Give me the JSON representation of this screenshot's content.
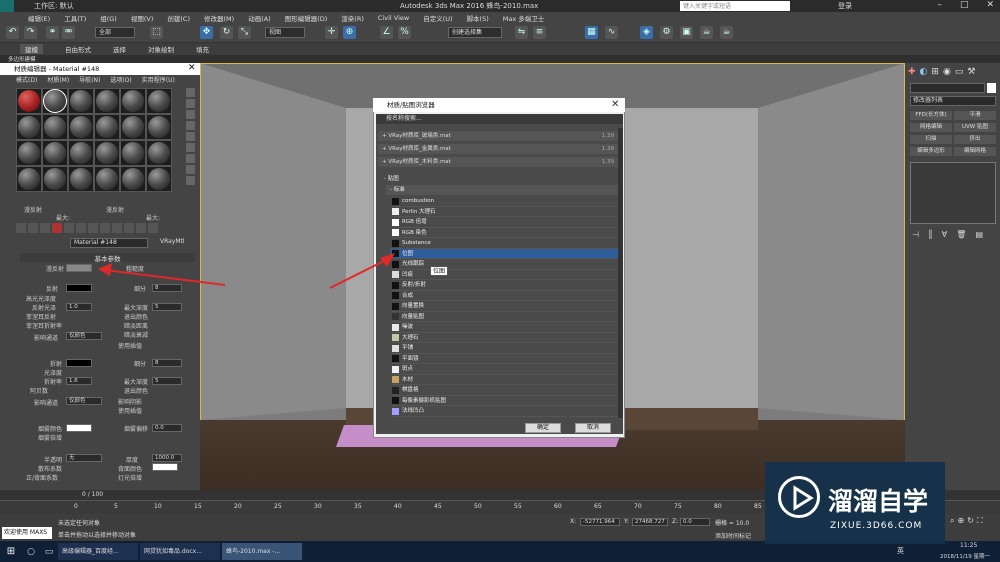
{
  "app": {
    "workspace": "工作区: 默认",
    "title": "Autodesk 3ds Max 2016    蜂鸟-2010.max",
    "search_placeholder": "键入关键字或短语",
    "user": "登录"
  },
  "menu": [
    "编辑(E)",
    "工具(T)",
    "组(G)",
    "视图(V)",
    "创建(C)",
    "修改器(M)",
    "动画(A)",
    "图形编辑器(D)",
    "渲染(R)",
    "Civil View",
    "自定义(U)",
    "脚本(S)",
    "Max 多端卫士"
  ],
  "toolbar": {
    "filter": "全部",
    "view": "视图",
    "selection_set": "创建选择集"
  },
  "ribbon": {
    "tabs": [
      "建模",
      "自由形式",
      "选择",
      "对象绘制",
      "填充"
    ],
    "sub": "多边形建模"
  },
  "material_editor": {
    "title": "材质编辑器 - Material #148",
    "menu": [
      "模式(D)",
      "材质(M)",
      "导航(N)",
      "选项(O)",
      "实用程序(U)"
    ],
    "rows1": [
      "漫反射",
      "最大:",
      "漫反射",
      "最大:"
    ],
    "name": "Material #148",
    "type": "VRayMtl",
    "rollout": "基本参数",
    "params": {
      "diffuse": "漫反射",
      "roughness": "粗糙度",
      "reflect": "反射",
      "hilight_gloss": "高光光泽度",
      "refl_gloss": "反射光泽",
      "fresnel": "菲涅耳反射",
      "fresnel_ior": "菲涅耳折射率",
      "subdivs": "细分",
      "max_depth": "最大深度",
      "exit_color": "退出颜色",
      "dim_dist": "暗淡距离",
      "dim_falloff": "暗淡衰减",
      "affect_channels": "影响通道",
      "only_color": "仅颜色",
      "use_interp": "使用插值",
      "refract": "折射",
      "glossiness": "光泽度",
      "ior": "折射率",
      "abbe": "阿贝数",
      "affect_shadows": "影响阴影",
      "fog_color": "烟雾颜色",
      "fog_mult": "烟雾倍增",
      "fog_bias": "烟雾偏移",
      "translucency": "半透明",
      "scatter_coeff": "散布系数",
      "fwd_bwd": "正/背面系数",
      "thickness": "厚度",
      "back_color": "背面颜色",
      "light_mult": "灯光倍增",
      "v_subdivs": "8",
      "v_depth": "5",
      "v_gloss": "1.0",
      "v_ior": "1.6",
      "v_fog_bias": "0.0",
      "v_thick": "1000.0",
      "none": "无"
    }
  },
  "dialog": {
    "title": "材质/贴图浏览器",
    "search": "按名称搜索...",
    "libraries": [
      {
        "name": "+ VRay材质库_玻璃类.mat",
        "size": "1.39"
      },
      {
        "name": "+ VRay材质库_金属类.mat",
        "size": "1.39"
      },
      {
        "name": "+ VRay材质库_木料类.mat",
        "size": "1.39"
      }
    ],
    "section": "- 贴图",
    "subsection": "- 标准",
    "maps": [
      {
        "name": "combustion",
        "color": "#111111"
      },
      {
        "name": "Perlin 大理石",
        "color": "#eeeeee"
      },
      {
        "name": "RGB 倍增",
        "color": "#ffffff"
      },
      {
        "name": "RGB 染色",
        "color": "#ffffff"
      },
      {
        "name": "Substance",
        "color": "#111111"
      },
      {
        "name": "位图",
        "color": "#111111"
      },
      {
        "name": "光线跟踪",
        "color": "#111111"
      },
      {
        "name": "凹痕",
        "color": "#dddddd"
      },
      {
        "name": "反射/折射",
        "color": "#111111"
      },
      {
        "name": "合成",
        "color": "#111111"
      },
      {
        "name": "向量置换",
        "color": "#111111"
      },
      {
        "name": "向量贴图",
        "color": "#333333"
      },
      {
        "name": "噪波",
        "color": "#e8e8e8"
      },
      {
        "name": "大理石",
        "color": "#c8c8a0"
      },
      {
        "name": "平铺",
        "color": "#e0e0e0"
      },
      {
        "name": "平面镜",
        "color": "#111111"
      },
      {
        "name": "斑点",
        "color": "#f0f0f0"
      },
      {
        "name": "木材",
        "color": "#c8a060"
      },
      {
        "name": "棋盘格",
        "color": "#222222"
      },
      {
        "name": "每像素摄影机贴图",
        "color": "#111111"
      },
      {
        "name": "法线凹凸",
        "color": "#a0a0ff"
      }
    ],
    "tooltip": "位图",
    "ok": "确定",
    "cancel": "取消"
  },
  "right_panel": {
    "modifier_list": "修改器列表",
    "buttons": [
      "FFD(长方体)",
      "平滑",
      "网格编辑",
      "UVW 贴图",
      "扫描",
      "挤出",
      "编辑多边形",
      "编辑网格"
    ]
  },
  "timeline": {
    "frame": "0 / 100",
    "ticks": [
      "0",
      "5",
      "10",
      "15",
      "20",
      "25",
      "30",
      "35",
      "40",
      "45",
      "50",
      "55",
      "60",
      "65",
      "70",
      "75",
      "80",
      "85"
    ]
  },
  "status": {
    "welcome": "欢迎使用 MAXS",
    "line1": "未选定任何对象",
    "line2": "单击并拖动以选择并移动对象",
    "x": "-52771.964",
    "y": "27468.727",
    "z": "0.0",
    "grid": "栅格 = 10.0",
    "add_time_tag": "添加时间标记"
  },
  "taskbar": {
    "items": [
      "高级编辑器_百度经...",
      "网贷犹如毒品.docx...",
      "蜂鸟-2010.max -..."
    ],
    "lang": "英",
    "time": "11:25",
    "date": "2018/11/19 星期一"
  },
  "watermark": {
    "brand": "溜溜自学",
    "url": "ZIXUE.3D66.COM"
  }
}
